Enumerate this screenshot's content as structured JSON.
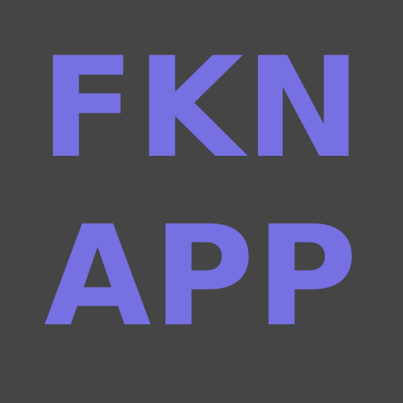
{
  "logo": {
    "line1": "FKN",
    "line2": "APP"
  },
  "colors": {
    "background": "#454545",
    "text": "#7670e3"
  }
}
